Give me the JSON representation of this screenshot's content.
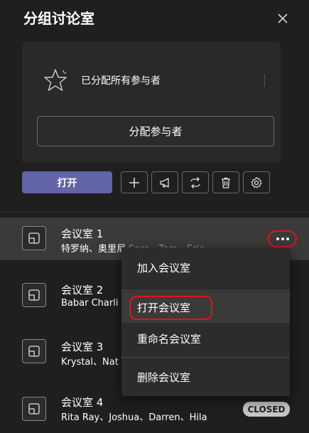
{
  "header": {
    "title": "分组讨论室"
  },
  "assign_card": {
    "message": "已分配所有参与者",
    "assign_button": "分配参与者"
  },
  "toolbar": {
    "open_button": "打开"
  },
  "rooms": [
    {
      "name": "会议室 1",
      "members_main": "特罗纳、奥里尼",
      "members_dim": "Sara、Tom、Eric"
    },
    {
      "name": "会议室 2",
      "members_main": "Babar Charli",
      "members_dim": ""
    },
    {
      "name": "会议室 3",
      "members_main": "Krystal、Nat",
      "members_dim": ""
    },
    {
      "name": "会议室 4",
      "members_main": "Rita Ray、Joshua、Darren、Hila",
      "members_dim": ""
    }
  ],
  "context_menu": {
    "items": [
      "加入会议室",
      "打开会议室",
      "重命名会议室",
      "删除会议室"
    ]
  },
  "status_badge": "CLOSED",
  "colors": {
    "accent": "#6264a7",
    "highlight_ring": "#e0131f"
  }
}
